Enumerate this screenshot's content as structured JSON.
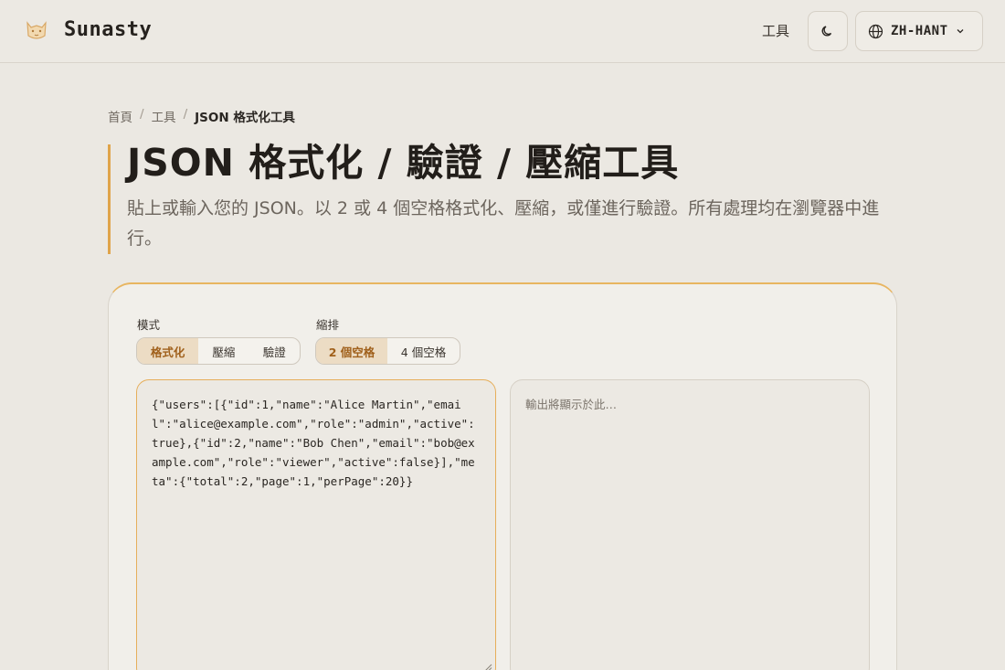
{
  "header": {
    "brand": "Sunasty",
    "nav_tools": "工具",
    "theme_icon": "moon-icon",
    "language": "ZH-HANT",
    "globe_icon": "globe-icon",
    "chevron_icon": "chevron-down-icon"
  },
  "breadcrumb": {
    "home": "首頁",
    "sep": "/",
    "tools": "工具",
    "current": "JSON 格式化工具"
  },
  "hero": {
    "title": "JSON 格式化 / 驗證 / 壓縮工具",
    "subtitle": "貼上或輸入您的 JSON。以 2 或 4 個空格格式化、壓縮，或僅進行驗證。所有處理均在瀏覽器中進行。"
  },
  "tool": {
    "mode_label": "模式",
    "modes": [
      "格式化",
      "壓縮",
      "驗證"
    ],
    "mode_selected": "格式化",
    "indent_label": "縮排",
    "indents": [
      "2 個空格",
      "4 個空格"
    ],
    "indent_selected": "2 個空格",
    "input_value": "{\"users\":[{\"id\":1,\"name\":\"Alice Martin\",\"email\":\"alice@example.com\",\"role\":\"admin\",\"active\":true},{\"id\":2,\"name\":\"Bob Chen\",\"email\":\"bob@example.com\",\"role\":\"viewer\",\"active\":false}],\"meta\":{\"total\":2,\"page\":1,\"perPage\":20}}",
    "output_placeholder": "輸出將顯示於此…"
  },
  "colors": {
    "accent": "#e0a44a",
    "active_segment_bg": "#ecdcc4",
    "active_segment_text": "#a0601b",
    "background": "#ebe8e2"
  }
}
